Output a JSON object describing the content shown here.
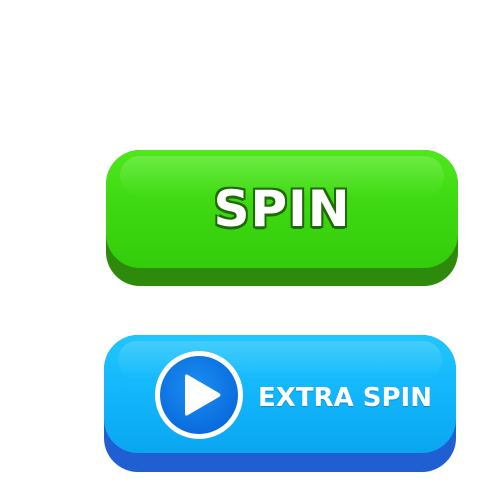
{
  "buttons": {
    "spin": {
      "label": "SPIN"
    },
    "extra_spin": {
      "label": "EXTRA SPIN",
      "icon": "play-icon"
    }
  },
  "colors": {
    "spin_face": "#3fd912",
    "spin_base": "#2e8a0a",
    "extra_face": "#12b6fb",
    "extra_base": "#1f5fd1",
    "play_badge": "#0b6fe0"
  }
}
